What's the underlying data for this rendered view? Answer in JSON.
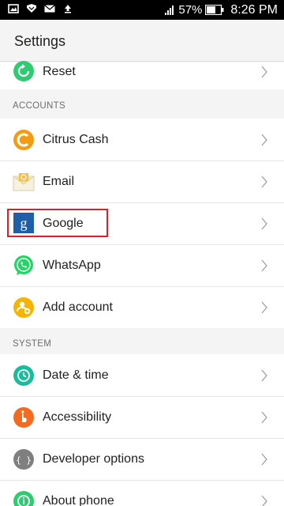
{
  "status_bar": {
    "battery": "57%",
    "time": "8:26 PM",
    "left_icons": [
      "image-icon",
      "shield-icon",
      "mail-icon",
      "upload-icon"
    ],
    "right_icons": [
      "signal-icon",
      "battery-icon"
    ]
  },
  "header": {
    "title": "Settings"
  },
  "items_top": [
    {
      "label": "Reset",
      "icon": "reset-icon",
      "color": "#2ecc71"
    }
  ],
  "sections": [
    {
      "title": "ACCOUNTS",
      "items": [
        {
          "label": "Citrus Cash",
          "icon": "citrus-cash-icon",
          "color": "#f39c12"
        },
        {
          "label": "Email",
          "icon": "email-icon",
          "color": "#f0c04a"
        },
        {
          "label": "Google",
          "icon": "google-icon",
          "color": "#1f5fa8"
        },
        {
          "label": "WhatsApp",
          "icon": "whatsapp-icon",
          "color": "#25d366"
        },
        {
          "label": "Add account",
          "icon": "add-account-icon",
          "color": "#f5b400"
        }
      ]
    },
    {
      "title": "SYSTEM",
      "items": [
        {
          "label": "Date & time",
          "icon": "clock-icon",
          "color": "#1abc9c"
        },
        {
          "label": "Accessibility",
          "icon": "accessibility-icon",
          "color": "#f26b21"
        },
        {
          "label": "Developer options",
          "icon": "developer-options-icon",
          "color": "#7f7f7f"
        },
        {
          "label": "About phone",
          "icon": "about-phone-icon",
          "color": "#2ecc71"
        }
      ]
    }
  ]
}
